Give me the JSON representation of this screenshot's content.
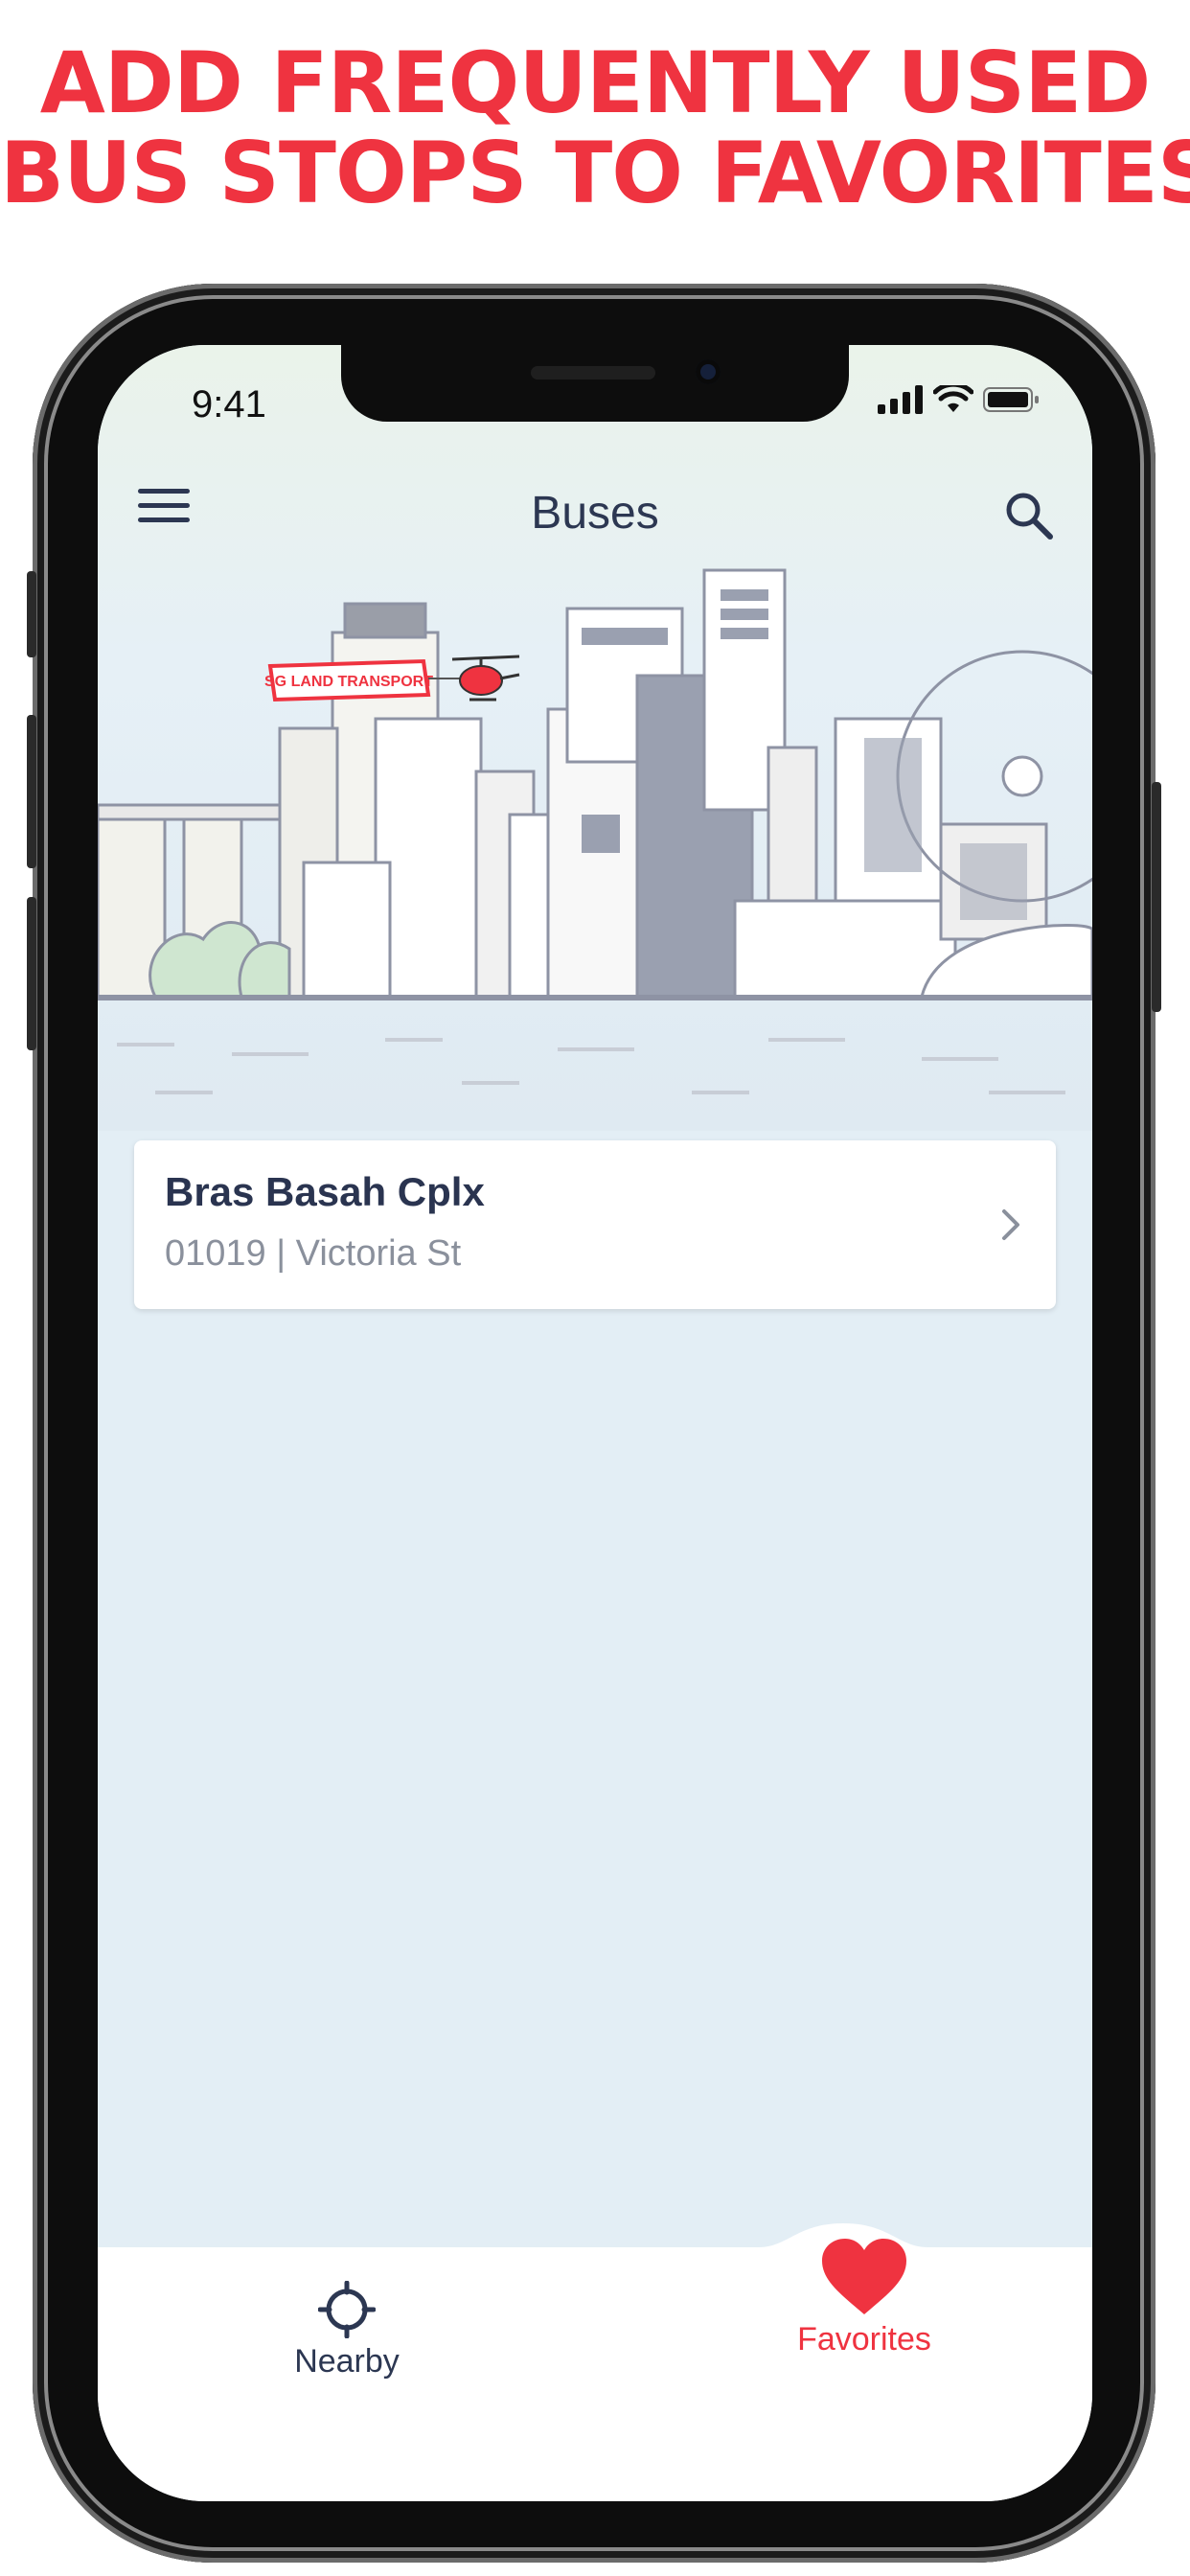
{
  "headline": {
    "line1": "ADD FREQUENTLY USED",
    "line2": "BUS STOPS TO FAVORITES",
    "color": "#ef3340"
  },
  "status_bar": {
    "time": "9:41",
    "icons": [
      "cellular-signal-icon",
      "wifi-icon",
      "battery-icon"
    ]
  },
  "nav": {
    "title": "Buses",
    "menu_icon": "hamburger-menu-icon",
    "search_icon": "search-icon"
  },
  "illustration": {
    "banner_text": "SG LAND TRANSPORT"
  },
  "favorites": [
    {
      "name": "Bras Basah Cplx",
      "details": "01019 | Victoria St"
    }
  ],
  "tabbar": {
    "tabs": [
      {
        "label": "Nearby",
        "icon": "crosshair-icon",
        "active": false
      },
      {
        "label": "Favorites",
        "icon": "heart-icon",
        "active": true
      }
    ],
    "active_color": "#ef3340",
    "inactive_color": "#2c3752"
  }
}
